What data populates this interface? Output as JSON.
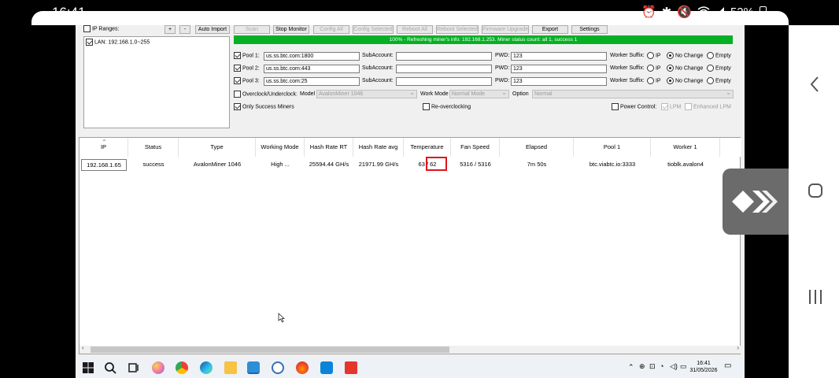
{
  "phone": {
    "time": "16:41",
    "battery": "52%"
  },
  "toolbar": {
    "ip_ranges": "IP Ranges:",
    "plus": "+",
    "minus": "-",
    "auto_import": "Auto Import",
    "scan": "Scan",
    "stop_monitor": "Stop Monitor",
    "config_all": "Config All",
    "config_selected": "Config Selected",
    "reboot_all": "Reboot All",
    "reboot_selected": "Reboot Selected",
    "firmware_upgrade": "Firmware Upgrade",
    "export": "Export",
    "settings": "Settings"
  },
  "lan": {
    "item": "LAN: 192.168.1.0~255"
  },
  "status_bar": {
    "text": "100% - Refreshing miner's info: 192.168.1.253. Miner status count: all 1, success 1"
  },
  "pools": [
    {
      "label": "Pool 1:",
      "url": "us.ss.btc.com:1800",
      "sub_label": "SubAccount:",
      "sub": "",
      "pwd_label": "PWD:",
      "pwd": "123",
      "suffix_label": "Worker Suffix:"
    },
    {
      "label": "Pool 2:",
      "url": "us.ss.btc.com:443",
      "sub_label": "SubAccount:",
      "sub": "",
      "pwd_label": "PWD:",
      "pwd": "123",
      "suffix_label": "Worker Suffix:"
    },
    {
      "label": "Pool 3:",
      "url": "us.ss.btc.com:25",
      "sub_label": "SubAccount:",
      "sub": "",
      "pwd_label": "PWD:",
      "pwd": "123",
      "suffix_label": "Worker Suffix:"
    }
  ],
  "suffix_options": {
    "ip": "IP",
    "no_change": "No Change",
    "empty": "Empty"
  },
  "overclock": {
    "label": "Overclock/Underclock:",
    "model_label": "Model",
    "model_value": "AvalonMiner 1046",
    "work_mode_label": "Work Mode",
    "work_mode_value": "Normal Mode",
    "option_label": "Option",
    "option_value": "Normal"
  },
  "options": {
    "only_success": "Only Success Miners",
    "re_overclocking": "Re-overclocking",
    "power_control": "Power Control:",
    "lpm": "LPM",
    "enhanced_lpm": "Enhanced LPM"
  },
  "table": {
    "headers": [
      "IP",
      "Status",
      "Type",
      "Working Mode",
      "Hash Rate RT",
      "Hash Rate avg",
      "Temperature",
      "Fan Speed",
      "Elapsed",
      "Pool 1",
      "Worker 1"
    ],
    "row": [
      "192.168.1.65",
      "success",
      "AvalonMiner 1046",
      "High ...",
      "25594.44 GH/s",
      "21971.99 GH/s",
      "63 / 62",
      "5316 / 5316",
      "7m 50s",
      "btc.viabtc.io:3333",
      "tioblk.avalon4"
    ]
  },
  "taskbar": {
    "time": "16:41",
    "date": "31/05/2026"
  }
}
